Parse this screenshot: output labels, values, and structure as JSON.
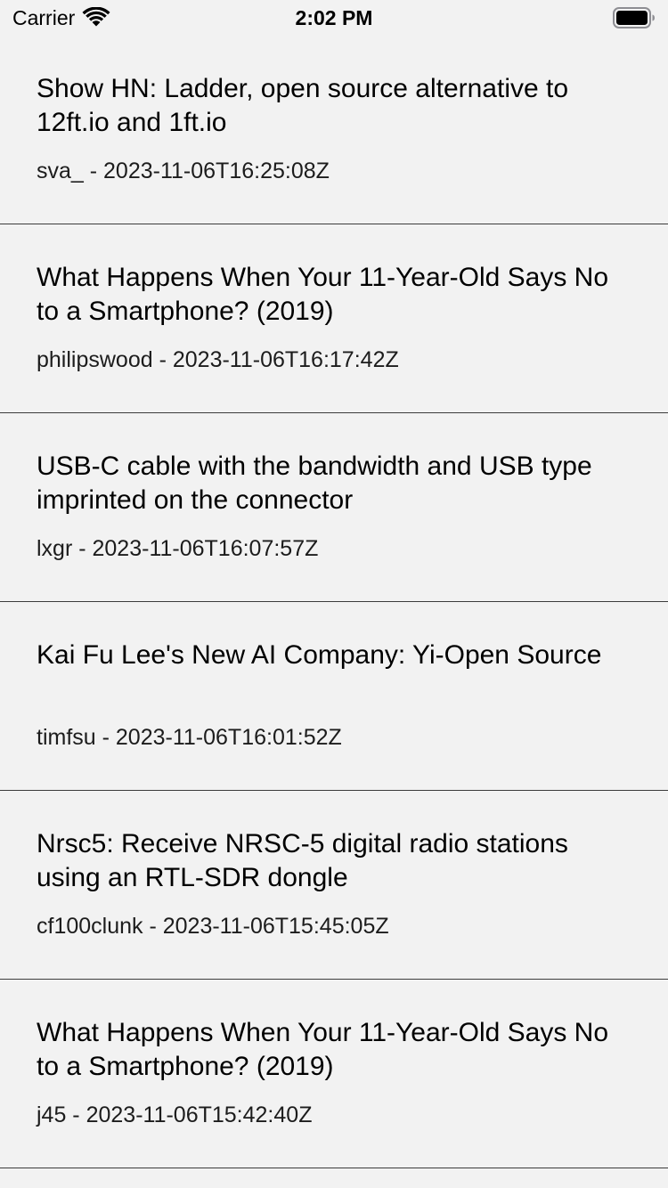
{
  "status_bar": {
    "carrier": "Carrier",
    "time": "2:02 PM",
    "wifi_icon": "wifi-icon",
    "battery_icon": "battery-full-icon"
  },
  "stories": [
    {
      "title": "Show HN: Ladder, open source alternative to 12ft.io and 1ft.io",
      "meta": "sva_ - 2023-11-06T16:25:08Z"
    },
    {
      "title": "What Happens When Your 11-Year-Old Says No to a Smartphone? (2019)",
      "meta": "philipswood - 2023-11-06T16:17:42Z"
    },
    {
      "title": "USB-C cable with the bandwidth and USB type imprinted on the connector",
      "meta": "lxgr - 2023-11-06T16:07:57Z"
    },
    {
      "title": "Kai Fu Lee's New AI Company: Yi-Open Source",
      "meta": "timfsu - 2023-11-06T16:01:52Z"
    },
    {
      "title": "Nrsc5: Receive NRSC-5 digital radio stations using an RTL-SDR dongle",
      "meta": "cf100clunk - 2023-11-06T15:45:05Z"
    },
    {
      "title": "What Happens When Your 11-Year-Old Says No to a Smartphone? (2019)",
      "meta": "j45 - 2023-11-06T15:42:40Z"
    }
  ]
}
